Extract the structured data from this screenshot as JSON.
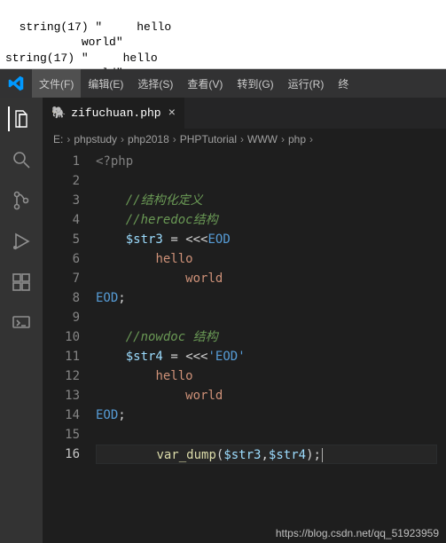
{
  "output": {
    "lines": [
      "string(17) \"     hello",
      "           world\"",
      "string(17) \"     hello",
      "           world\""
    ]
  },
  "menubar": {
    "items": [
      {
        "label": "文件(F)",
        "active": true
      },
      {
        "label": "编辑(E)"
      },
      {
        "label": "选择(S)"
      },
      {
        "label": "查看(V)"
      },
      {
        "label": "转到(G)"
      },
      {
        "label": "运行(R)"
      },
      {
        "label": "终"
      }
    ]
  },
  "tab": {
    "filename": "zifuchuan.php",
    "close_glyph": "×",
    "icon_glyph": "🐘"
  },
  "breadcrumbs": {
    "items": [
      "E:",
      "phpstudy",
      "php2018",
      "PHPTutorial",
      "WWW",
      "php"
    ],
    "sep": "›"
  },
  "code": {
    "lines": [
      {
        "n": 1,
        "plain": "<?php"
      },
      {
        "n": 2,
        "plain": ""
      },
      {
        "n": 3,
        "plain": "    //结构化定义"
      },
      {
        "n": 4,
        "plain": "    //heredoc结构"
      },
      {
        "n": 5,
        "plain": "    $str3 = <<<EOD"
      },
      {
        "n": 6,
        "plain": "        hello"
      },
      {
        "n": 7,
        "plain": "            world"
      },
      {
        "n": 8,
        "plain": "EOD;"
      },
      {
        "n": 9,
        "plain": ""
      },
      {
        "n": 10,
        "plain": "    //nowdoc 结构"
      },
      {
        "n": 11,
        "plain": "    $str4 = <<<'EOD'"
      },
      {
        "n": 12,
        "plain": "        hello"
      },
      {
        "n": 13,
        "plain": "            world"
      },
      {
        "n": 14,
        "plain": "EOD;"
      },
      {
        "n": 15,
        "plain": ""
      },
      {
        "n": 16,
        "plain": "        var_dump($str3,$str4);",
        "current": true
      }
    ]
  },
  "watermark": "https://blog.csdn.net/qq_51923959"
}
